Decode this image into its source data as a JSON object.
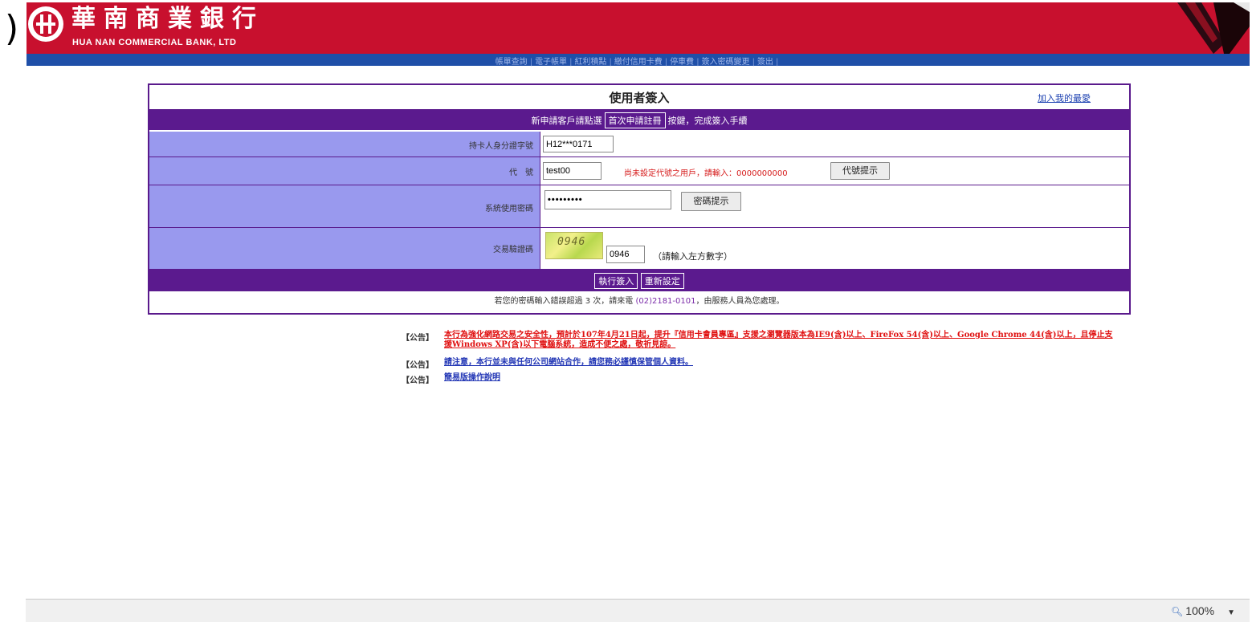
{
  "colors": {
    "header_red": "#c8102e",
    "nav_blue": "#1f4fa8",
    "panel_purple": "#5b1a8e",
    "label_bg": "#9999ee",
    "warn_red": "#d61c1c",
    "link_blue": "#1a3fb0"
  },
  "stray_glyph": ")",
  "header": {
    "bank_name_cn": "華南商業銀行",
    "bank_name_en": "HUA NAN COMMERCIAL BANK, LTD",
    "logo_icon": "hua-nan-logo-icon"
  },
  "nav": {
    "items": [
      "帳單查詢",
      "電子帳單",
      "紅利積點",
      "繳付信用卡費",
      "停車費",
      "簽入密碼變更",
      "簽出"
    ],
    "separator": "|"
  },
  "login": {
    "title": "使用者簽入",
    "favorites_link": "加入我的最愛",
    "notice_before": "新申請客戶請點選",
    "first_apply_button": "首次申請註冊",
    "notice_after": "按鍵，完成簽入手續",
    "id_label": "持卡人身分證字號",
    "id_value": "H12***0171",
    "code_label": "代　號",
    "code_value": "test00",
    "code_warning": "尚未設定代號之用戶，請輸入：0000000000",
    "code_hint_button": "代號提示",
    "password_label": "系統使用密碼",
    "password_value": "•••••••••",
    "password_hint_button": "密碼提示",
    "captcha_label": "交易驗證碼",
    "captcha_image_text": "0946",
    "captcha_value": "0946",
    "captcha_hint": "（請輸入左方數字）",
    "submit_button": "執行簽入",
    "reset_button": "重新設定",
    "footer_before": "若您的密碼輸入錯誤超過 3 次，請來電",
    "footer_phone": "(02)2181-0101",
    "footer_after": "，由服務人員為您處理。"
  },
  "announcements": [
    {
      "tag": "【公告】",
      "text": "本行為強化網路交易之安全性，預計於107年4月21日起，提升『信用卡會員專區』支援之瀏覽器版本為IE9(含)以上、FireFox 54(含)以上、Google Chrome 44(含)以上，且停止支援Windows XP(含)以下電腦系統，造成不便之處，敬祈見諒。"
    },
    {
      "tag": "【公告】",
      "text": "請注意，本行並未與任何公司網站合作，請您務必謹慎保管個人資料。"
    },
    {
      "tag": "【公告】",
      "text": "簡易版操作說明"
    }
  ],
  "statusbar": {
    "zoom": "100%",
    "zoom_icon": "magnifier-icon",
    "dropdown_icon": "dropdown-arrow-icon"
  }
}
